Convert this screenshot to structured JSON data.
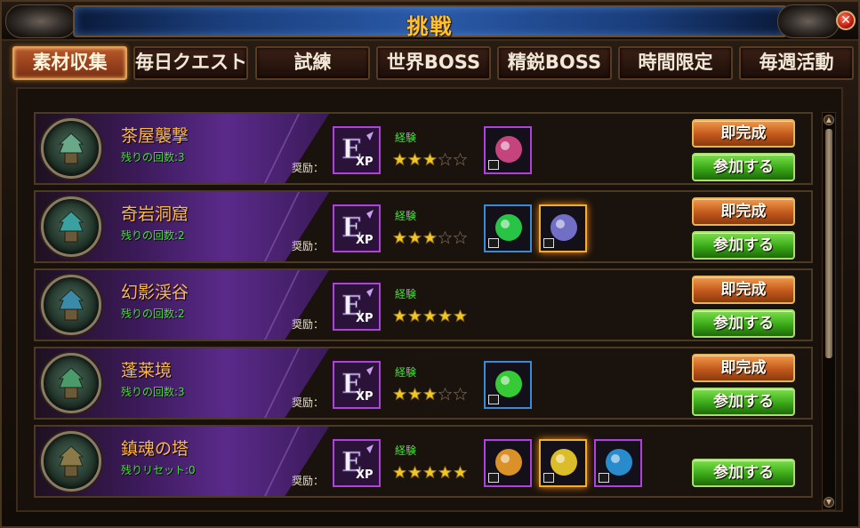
{
  "window": {
    "title": "挑戦"
  },
  "tabs": [
    {
      "label": "素材収集",
      "active": true
    },
    {
      "label": "毎日クエスト",
      "active": false
    },
    {
      "label": "試練",
      "active": false
    },
    {
      "label": "世界BOSS",
      "active": false
    },
    {
      "label": "精鋭BOSS",
      "active": false
    },
    {
      "label": "時間限定",
      "active": false
    },
    {
      "label": "毎週活動",
      "active": false
    }
  ],
  "rows": [
    {
      "name": "茶屋襲撃",
      "remaining": "残りの回数:3",
      "reward_label": "奨励：",
      "exp_label": "経験",
      "stars": 3,
      "complete_label": "即完成",
      "join_label": "参加する",
      "items": [
        "amulet-icon"
      ]
    },
    {
      "name": "奇岩洞窟",
      "remaining": "残りの回数:2",
      "reward_label": "奨励：",
      "exp_label": "経験",
      "stars": 3,
      "complete_label": "即完成",
      "join_label": "参加する",
      "items": [
        "green-crystal-icon",
        "spiral-orb-icon"
      ]
    },
    {
      "name": "幻影渓谷",
      "remaining": "残りの回数:2",
      "reward_label": "奨励：",
      "exp_label": "経験",
      "stars": 5,
      "complete_label": "即完成",
      "join_label": "参加する",
      "items": []
    },
    {
      "name": "蓬莱境",
      "remaining": "残りの回数:3",
      "reward_label": "奨励：",
      "exp_label": "経験",
      "stars": 3,
      "complete_label": "即完成",
      "join_label": "参加する",
      "items": [
        "green-orb-icon"
      ]
    },
    {
      "name": "鎮魂の塔",
      "remaining": "残りリセット:0",
      "reward_label": "奨励：",
      "exp_label": "経験",
      "stars": 5,
      "complete_label": "",
      "join_label": "参加する",
      "items": [
        "fire-gem-icon",
        "gold-coin-icon",
        "blue-swirl-icon"
      ]
    }
  ],
  "colors": {
    "accent_orange": "#c2581c",
    "accent_green": "#3aa818",
    "title_gold": "#ffc22a",
    "name_orange": "#ffb94a",
    "remain_green": "#43e03a"
  }
}
